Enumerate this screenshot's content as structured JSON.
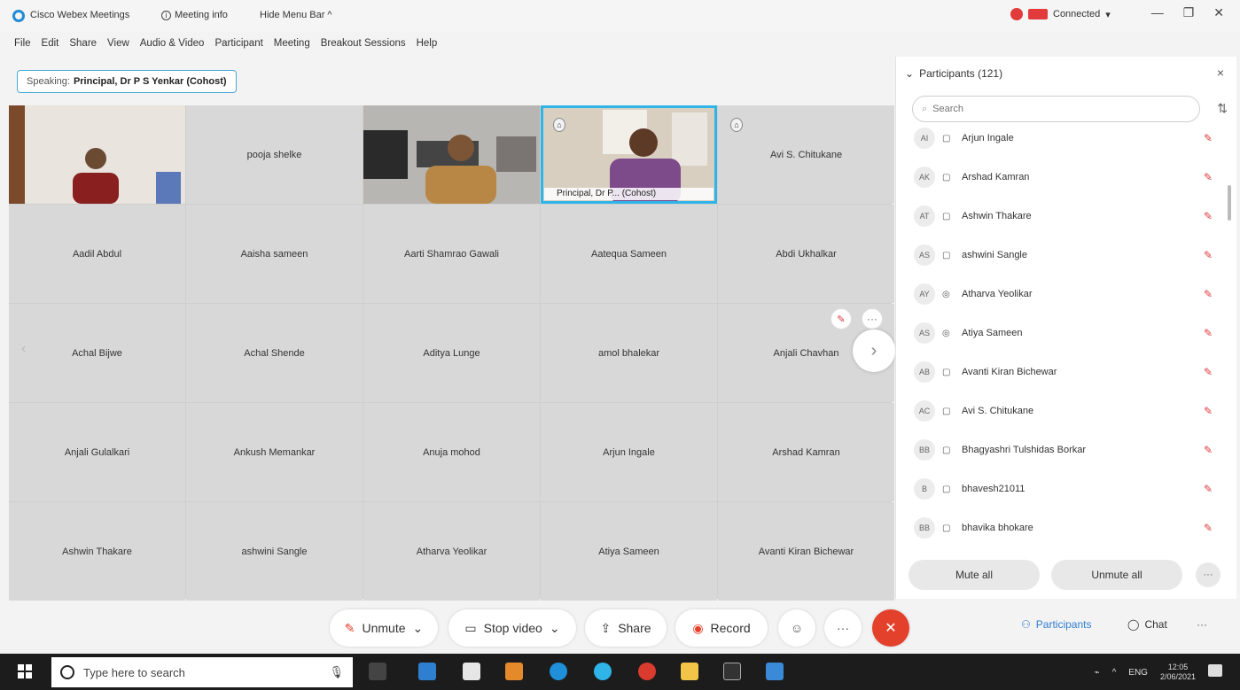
{
  "titlebar": {
    "app_title": "Cisco Webex Meetings",
    "meeting_info": "Meeting info",
    "hide_menu": "Hide Menu Bar ^",
    "connected": "Connected",
    "connected_arrow": "▾",
    "minimize": "—",
    "restore": "❐",
    "close": "✕"
  },
  "menu": [
    "File",
    "Edit",
    "Share",
    "View",
    "Audio & Video",
    "Participant",
    "Meeting",
    "Breakout Sessions",
    "Help"
  ],
  "speaking": {
    "label": "Speaking:",
    "name": "Principal, Dr P S Yenkar (Cohost)"
  },
  "grid": {
    "row1": [
      {
        "type": "video",
        "name": ""
      },
      {
        "type": "name",
        "name": "pooja shelke"
      },
      {
        "type": "video",
        "name": ""
      },
      {
        "type": "video",
        "name": "Principal, Dr P... (Cohost)"
      },
      {
        "type": "name",
        "name": "Avi S. Chitukane"
      }
    ],
    "names": [
      "Aadil Abdul",
      "Aaisha sameen",
      "Aarti Shamrao Gawali",
      "Aatequa Sameen",
      "Abdi Ukhalkar",
      "Achal Bijwe",
      "Achal Shende",
      "Aditya Lunge",
      "amol bhalekar",
      "Anjali Chavhan",
      "Anjali Gulalkari",
      "Ankush Memankar",
      "Anuja mohod",
      "Arjun Ingale",
      "Arshad Kamran",
      "Ashwin Thakare",
      "ashwini Sangle",
      "Atharva Yeolikar",
      "Atiya Sameen",
      "Avanti Kiran Bichewar"
    ],
    "next_icon": "›",
    "prev_icon": "‹",
    "more_icon": "···"
  },
  "panel": {
    "title": "Participants (121)",
    "collapse_icon": "⌄",
    "close_icon": "×",
    "search_placeholder": "Search",
    "participants": [
      {
        "initials": "AI",
        "name": "Arjun Ingale"
      },
      {
        "initials": "AK",
        "name": "Arshad Kamran"
      },
      {
        "initials": "AT",
        "name": "Ashwin Thakare"
      },
      {
        "initials": "AS",
        "name": "ashwini Sangle"
      },
      {
        "initials": "AY",
        "name": "Atharva Yeolikar"
      },
      {
        "initials": "AS",
        "name": "Atiya Sameen"
      },
      {
        "initials": "AB",
        "name": "Avanti Kiran Bichewar"
      },
      {
        "initials": "AC",
        "name": "Avi S. Chitukane"
      },
      {
        "initials": "BB",
        "name": "Bhagyashri Tulshidas Borkar"
      },
      {
        "initials": "B",
        "name": "bhavesh21011"
      },
      {
        "initials": "BB",
        "name": "bhavika bhokare"
      }
    ],
    "mute_all": "Mute all",
    "unmute_all": "Unmute all",
    "more": "···"
  },
  "controls": {
    "unmute": "Unmute",
    "stop_video": "Stop video",
    "share": "Share",
    "record": "Record",
    "participants": "Participants",
    "chat": "Chat",
    "dropdown": "⌄",
    "more": "···",
    "end": "✕",
    "reactions": "☺"
  },
  "taskbar": {
    "search_placeholder": "Type here to search",
    "lang": "ENG",
    "time": "12:05",
    "date": "2/06/2021"
  },
  "colors": {
    "accent": "#2fb4e8",
    "danger": "#e4412c",
    "taskbar": "#1c1c1c"
  }
}
